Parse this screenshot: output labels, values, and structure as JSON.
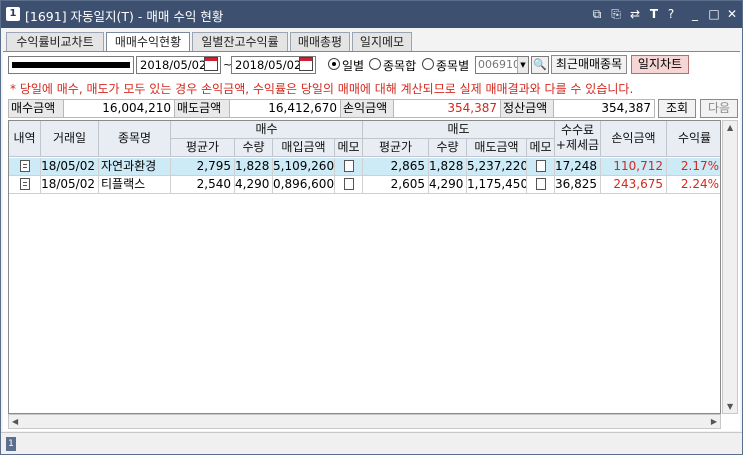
{
  "window": {
    "app_icon": "1",
    "title": "[1691] 자동일지(T) - 매매 수익 현황",
    "buttons": {
      "restore": "⧉",
      "copy": "⎘",
      "link": "⇄",
      "font": "T",
      "help": "?",
      "min": "_",
      "max": "□",
      "close": "✕"
    }
  },
  "tabs": [
    "수익률비교차트",
    "매매수익현황",
    "일별잔고수익률",
    "매매총평",
    "일지메모"
  ],
  "toolbar": {
    "date_from": "2018/05/02",
    "date_to": "2018/05/02",
    "tilde": "~",
    "radios": [
      {
        "label": "일별",
        "selected": true
      },
      {
        "label": "종목합",
        "selected": false
      },
      {
        "label": "종목별",
        "selected": false
      }
    ],
    "stock_code": "006910",
    "recent_btn": "최근매매종목",
    "chart_btn": "일지차트"
  },
  "notice": "* 당일에 매수, 매도가 모두 있는 경우 손익금액, 수익률은 당일의 매매에 대해 계산되므로 실제 매매결과와 다를 수 있습니다.",
  "summary": {
    "buy_label": "매수금액",
    "buy_value": "16,004,210",
    "sell_label": "매도금액",
    "sell_value": "16,412,670",
    "profit_label": "손익금액",
    "profit_value": "354,387",
    "settle_label": "정산금액",
    "settle_value": "354,387",
    "query_btn": "조회",
    "next_btn": "다음"
  },
  "grid": {
    "headers": {
      "detail": "내역",
      "date": "거래일",
      "name": "종목명",
      "buy_group": "매수",
      "sell_group": "매도",
      "buy_avg": "평균가",
      "buy_qty": "수량",
      "buy_amount": "매입금액",
      "buy_memo": "메모",
      "sell_avg": "평균가",
      "sell_qty": "수량",
      "sell_amount": "매도금액",
      "sell_memo": "메모",
      "fee_line1": "수수료",
      "fee_line2": "+제세금",
      "profit": "손익금액",
      "rate": "수익률"
    },
    "rows": [
      {
        "date": "18/05/02",
        "name": "자연과환경",
        "buy_avg": "2,795",
        "buy_qty": "1,828",
        "buy_amount": "5,109,260",
        "sell_avg": "2,865",
        "sell_qty": "1,828",
        "sell_amount": "5,237,220",
        "fee": "17,248",
        "profit": "110,712",
        "rate": "2.17%"
      },
      {
        "date": "18/05/02",
        "name": "티플랙스",
        "buy_avg": "2,540",
        "buy_qty": "4,290",
        "buy_amount": "0,896,600",
        "sell_avg": "2,605",
        "sell_qty": "4,290",
        "sell_amount": "1,175,450",
        "fee": "36,825",
        "profit": "243,675",
        "rate": "2.24%"
      }
    ]
  },
  "colors": {
    "title_bar": "#3e5070",
    "accent_red": "#d5281e",
    "selected_row": "#cdeaf7",
    "header_bg": "#e8ecf3"
  },
  "icons": [
    "app-icon",
    "calendar-icon",
    "search-icon",
    "detail-doc-icon",
    "memo-icon",
    "scroll-arrow-icon"
  ]
}
